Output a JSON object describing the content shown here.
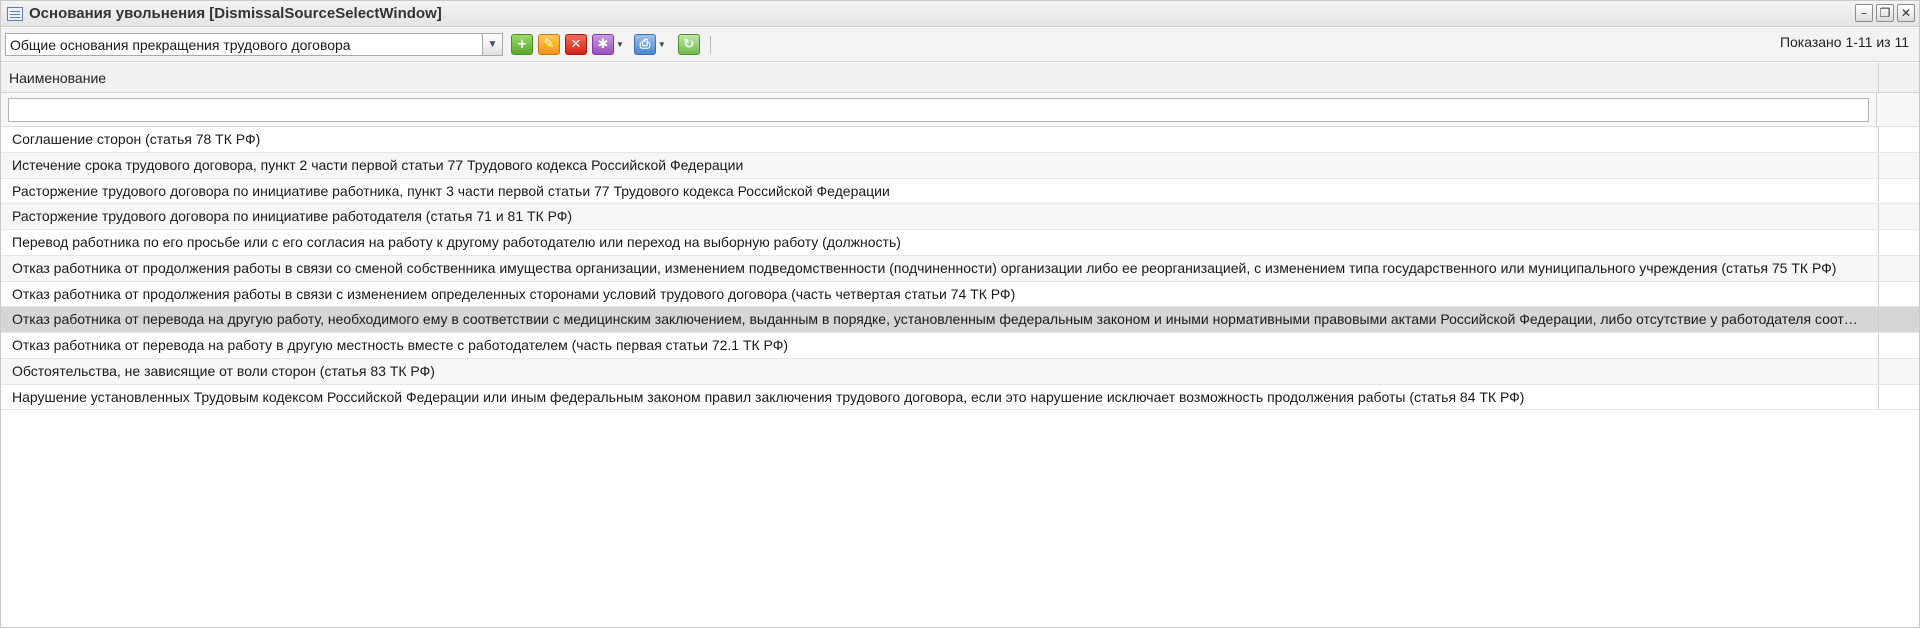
{
  "window": {
    "title": "Основания увольнения [DismissalSourceSelectWindow]",
    "controls": [
      "–",
      "❐",
      "✕"
    ]
  },
  "toolbar": {
    "filter_select_value": "Общие основания прекращения трудового договора",
    "buttons": [
      "add-icon",
      "edit-icon",
      "delete-icon",
      "more-icon",
      "print-icon",
      "refresh-icon"
    ],
    "paging_text": "Показано 1-11 из 11"
  },
  "grid": {
    "columns": [
      "Наименование",
      ""
    ],
    "filter_value": "",
    "rows": [
      {
        "name": "Соглашение сторон (статья 78 ТК РФ)",
        "code": "",
        "selected": false
      },
      {
        "name": "Истечение срока трудового договора, пункт 2 части первой статьи 77 Трудового кодекса Российской Федерации",
        "code": "",
        "selected": false
      },
      {
        "name": "Расторжение трудового договора по инициативе работника, пункт 3 части первой статьи 77 Трудового кодекса Российской Федерации",
        "code": "",
        "selected": false
      },
      {
        "name": "Расторжение трудового договора по инициативе работодателя (статья 71 и 81 ТК РФ)",
        "code": "",
        "selected": false
      },
      {
        "name": "Перевод работника по его просьбе или с его согласия на работу к другому работодателю или переход на выборную работу (должность)",
        "code": "",
        "selected": false
      },
      {
        "name": "Отказ работника от продолжения работы в связи со сменой собственника имущества организации, изменением подведомственности (подчиненности) организации либо ее реорганизацией, с изменением типа государственного или муниципального учреждения (статья 75 ТК РФ)",
        "code": "",
        "selected": false
      },
      {
        "name": "Отказ работника от продолжения работы в связи с изменением определенных сторонами условий трудового договора (часть четвертая статьи 74 ТК РФ)",
        "code": "",
        "selected": false
      },
      {
        "name": "Отказ работника от перевода на другую работу, необходимого ему в соответствии с медицинским заключением, выданным в порядке, установленным федеральным законом и иными нормативными правовыми актами Российской Федерации, либо отсутствие у работодателя соответствующей работы",
        "code": "",
        "selected": true
      },
      {
        "name": "Отказ работника от перевода на работу в другую местность вместе с работодателем (часть первая статьи 72.1 ТК РФ)",
        "code": "",
        "selected": false
      },
      {
        "name": "Обстоятельства, не зависящие от воли сторон (статья 83 ТК РФ)",
        "code": "",
        "selected": false
      },
      {
        "name": "Нарушение установленных Трудовым кодексом Российской Федерации или иным федеральным законом правил заключения трудового договора, если это нарушение исключает возможность продолжения работы (статья 84 ТК РФ)",
        "code": "",
        "selected": false
      }
    ]
  }
}
